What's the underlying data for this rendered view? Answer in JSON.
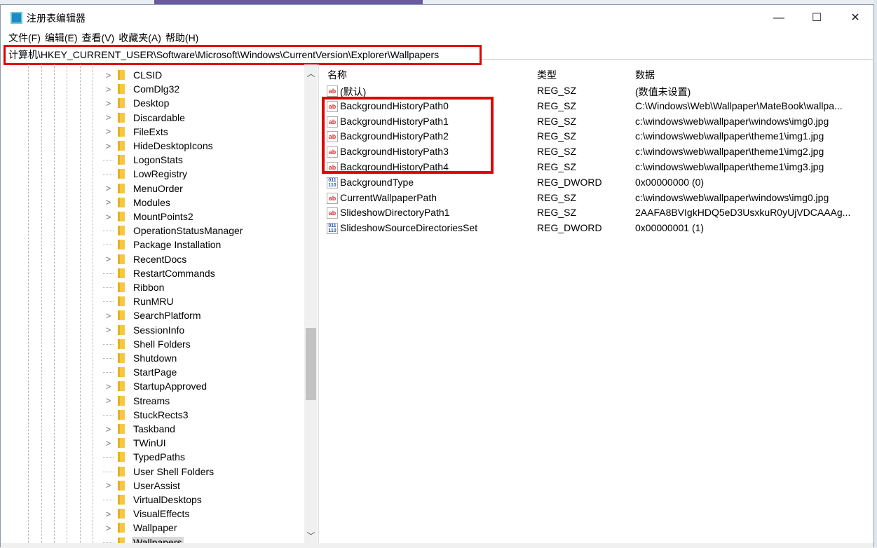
{
  "window": {
    "title": "注册表编辑器",
    "minimize": "—",
    "maximize": "☐",
    "close": "✕"
  },
  "menu": [
    "文件(F)",
    "编辑(E)",
    "查看(V)",
    "收藏夹(A)",
    "帮助(H)"
  ],
  "address": "计算机\\HKEY_CURRENT_USER\\Software\\Microsoft\\Windows\\CurrentVersion\\Explorer\\Wallpapers",
  "tree": [
    {
      "label": "CLSID",
      "expandable": true
    },
    {
      "label": "ComDlg32",
      "expandable": true
    },
    {
      "label": "Desktop",
      "expandable": true
    },
    {
      "label": "Discardable",
      "expandable": true
    },
    {
      "label": "FileExts",
      "expandable": true
    },
    {
      "label": "HideDesktopIcons",
      "expandable": true
    },
    {
      "label": "LogonStats",
      "expandable": false
    },
    {
      "label": "LowRegistry",
      "expandable": false
    },
    {
      "label": "MenuOrder",
      "expandable": true
    },
    {
      "label": "Modules",
      "expandable": true
    },
    {
      "label": "MountPoints2",
      "expandable": true
    },
    {
      "label": "OperationStatusManager",
      "expandable": false
    },
    {
      "label": "Package Installation",
      "expandable": false
    },
    {
      "label": "RecentDocs",
      "expandable": true
    },
    {
      "label": "RestartCommands",
      "expandable": false
    },
    {
      "label": "Ribbon",
      "expandable": false
    },
    {
      "label": "RunMRU",
      "expandable": false
    },
    {
      "label": "SearchPlatform",
      "expandable": true
    },
    {
      "label": "SessionInfo",
      "expandable": true
    },
    {
      "label": "Shell Folders",
      "expandable": false
    },
    {
      "label": "Shutdown",
      "expandable": false
    },
    {
      "label": "StartPage",
      "expandable": false
    },
    {
      "label": "StartupApproved",
      "expandable": true
    },
    {
      "label": "Streams",
      "expandable": true
    },
    {
      "label": "StuckRects3",
      "expandable": false
    },
    {
      "label": "Taskband",
      "expandable": true
    },
    {
      "label": "TWinUI",
      "expandable": true
    },
    {
      "label": "TypedPaths",
      "expandable": false
    },
    {
      "label": "User Shell Folders",
      "expandable": false
    },
    {
      "label": "UserAssist",
      "expandable": true
    },
    {
      "label": "VirtualDesktops",
      "expandable": false
    },
    {
      "label": "VisualEffects",
      "expandable": true
    },
    {
      "label": "Wallpaper",
      "expandable": true
    },
    {
      "label": "Wallpapers",
      "expandable": false,
      "selected": true
    }
  ],
  "columns": {
    "name": "名称",
    "type": "类型",
    "data": "数据"
  },
  "values": [
    {
      "icon": "ab",
      "name": "(默认)",
      "type": "REG_SZ",
      "data": "(数值未设置)"
    },
    {
      "icon": "ab",
      "name": "BackgroundHistoryPath0",
      "type": "REG_SZ",
      "data": "C:\\Windows\\Web\\Wallpaper\\MateBook\\wallpa..."
    },
    {
      "icon": "ab",
      "name": "BackgroundHistoryPath1",
      "type": "REG_SZ",
      "data": "c:\\windows\\web\\wallpaper\\windows\\img0.jpg"
    },
    {
      "icon": "ab",
      "name": "BackgroundHistoryPath2",
      "type": "REG_SZ",
      "data": "c:\\windows\\web\\wallpaper\\theme1\\img1.jpg"
    },
    {
      "icon": "ab",
      "name": "BackgroundHistoryPath3",
      "type": "REG_SZ",
      "data": "c:\\windows\\web\\wallpaper\\theme1\\img2.jpg"
    },
    {
      "icon": "ab",
      "name": "BackgroundHistoryPath4",
      "type": "REG_SZ",
      "data": "c:\\windows\\web\\wallpaper\\theme1\\img3.jpg"
    },
    {
      "icon": "bin",
      "name": "BackgroundType",
      "type": "REG_DWORD",
      "data": "0x00000000 (0)"
    },
    {
      "icon": "ab",
      "name": "CurrentWallpaperPath",
      "type": "REG_SZ",
      "data": "c:\\windows\\web\\wallpaper\\windows\\img0.jpg"
    },
    {
      "icon": "ab",
      "name": "SlideshowDirectoryPath1",
      "type": "REG_SZ",
      "data": "2AAFA8BVIgkHDQ5eD3UsxkuR0yUjVDCAAAg..."
    },
    {
      "icon": "bin",
      "name": "SlideshowSourceDirectoriesSet",
      "type": "REG_DWORD",
      "data": "0x00000001 (1)"
    }
  ],
  "highlight_color": "#e00000"
}
